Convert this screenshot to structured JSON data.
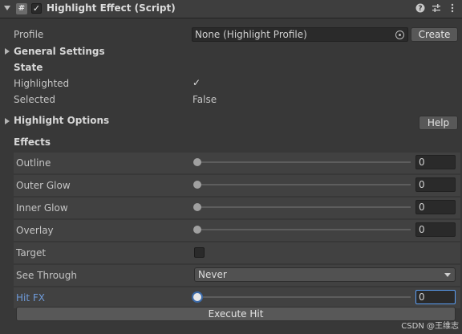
{
  "component": {
    "title": "Highlight Effect (Script)",
    "script_icon": "#",
    "enabled_mark": "✓"
  },
  "profile": {
    "label": "Profile",
    "value": "None (Highlight Profile)",
    "create_label": "Create"
  },
  "general_settings": {
    "label": "General Settings"
  },
  "state": {
    "label": "State",
    "highlighted_label": "Highlighted",
    "highlighted_check": "✓",
    "selected_label": "Selected",
    "selected_value": "False"
  },
  "highlight_options": {
    "label": "Highlight Options",
    "help_label": "Help"
  },
  "effects": {
    "label": "Effects",
    "rows": [
      {
        "label": "Outline",
        "value": "0"
      },
      {
        "label": "Outer Glow",
        "value": "0"
      },
      {
        "label": "Inner Glow",
        "value": "0"
      },
      {
        "label": "Overlay",
        "value": "0"
      }
    ],
    "target_label": "Target",
    "see_through_label": "See Through",
    "see_through_value": "Never",
    "hit_fx_label": "Hit FX",
    "hit_fx_value": "0",
    "execute_hit_label": "Execute Hit"
  },
  "watermark": "CSDN @王维志",
  "colors": {
    "background": "#383838",
    "row": "#414141",
    "accent_blue": "#5b9ef4",
    "hit_fx_label": "#6e9ad8"
  }
}
